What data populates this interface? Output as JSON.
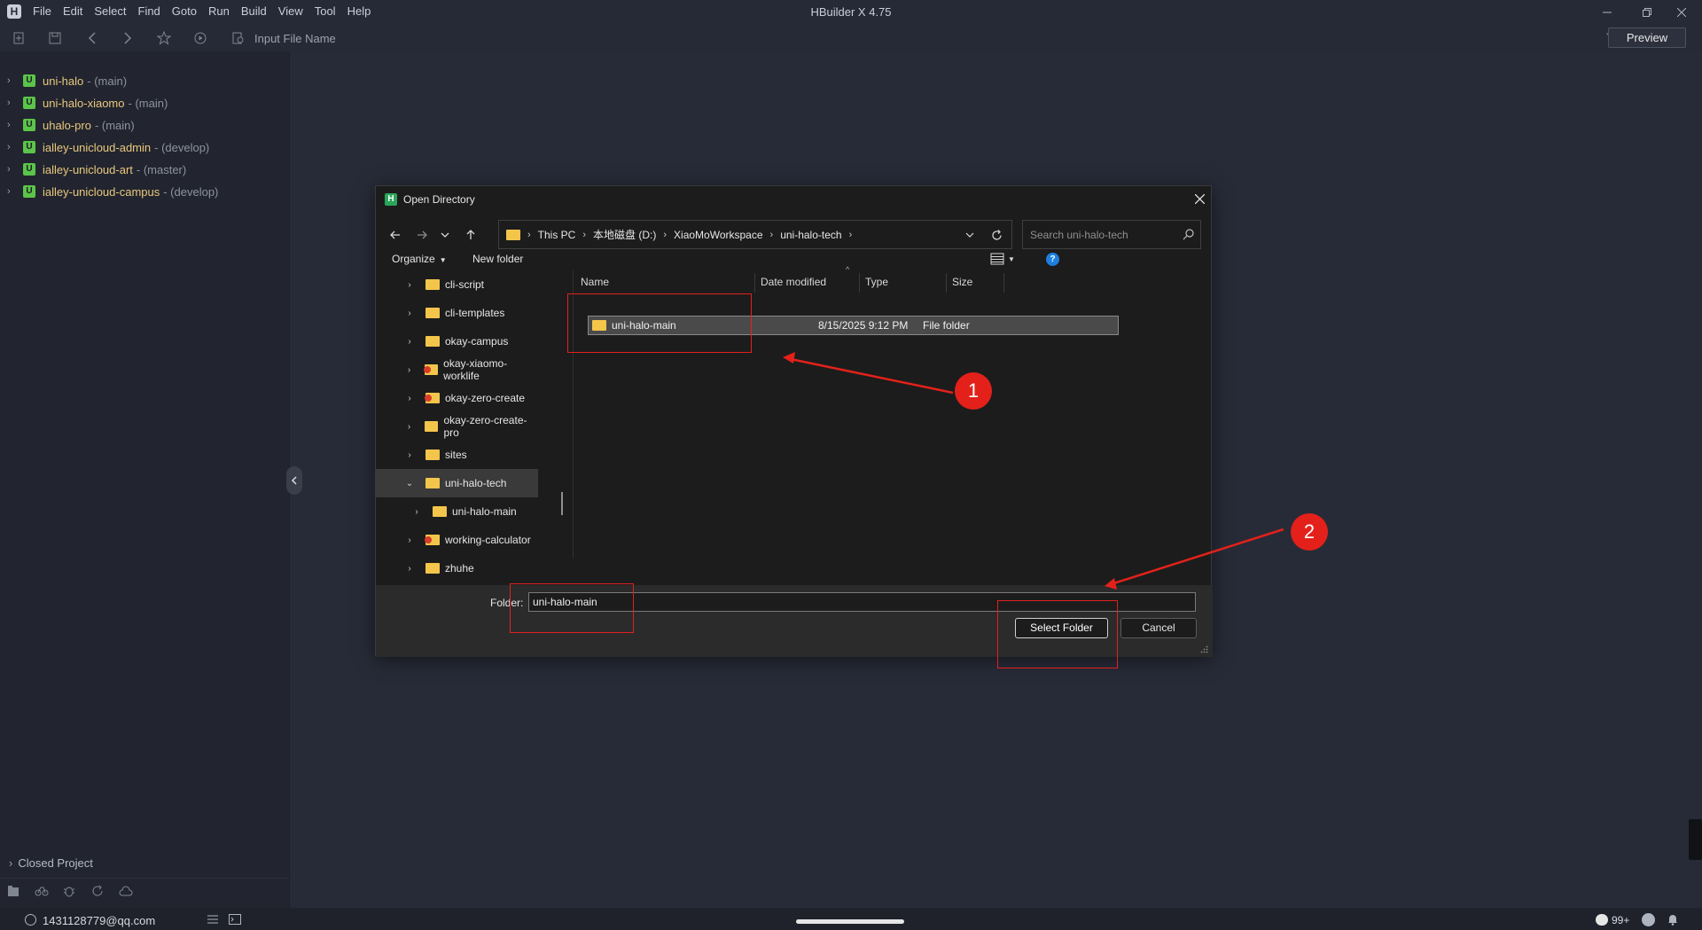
{
  "window": {
    "title": "HBuilder X 4.75",
    "logo": "H",
    "menu": [
      "File",
      "Edit",
      "Select",
      "Find",
      "Goto",
      "Run",
      "Build",
      "View",
      "Tool",
      "Help"
    ]
  },
  "toolbar": {
    "file_input_placeholder": "Input File Name",
    "preview_label": "Preview"
  },
  "sidebar": {
    "projects": [
      {
        "name": "uni-halo",
        "branch": "- (main)"
      },
      {
        "name": "uni-halo-xiaomo",
        "branch": "- (main)"
      },
      {
        "name": "uhalo-pro",
        "branch": "- (main)"
      },
      {
        "name": "ialley-unicloud-admin",
        "branch": "- (develop)"
      },
      {
        "name": "ialley-unicloud-art",
        "branch": "- (master)"
      },
      {
        "name": "ialley-unicloud-campus",
        "branch": "- (develop)"
      }
    ],
    "project_badge": "U",
    "closed_project_label": "Closed Project"
  },
  "statusbar": {
    "account": "1431128779@qq.com",
    "notification_count": "99+"
  },
  "dialog": {
    "title": "Open Directory",
    "breadcrumb": [
      "This PC",
      "本地磁盘 (D:)",
      "XiaoMoWorkspace",
      "uni-halo-tech"
    ],
    "search_placeholder": "Search uni-halo-tech",
    "organize_label": "Organize",
    "new_folder_label": "New folder",
    "help_glyph": "?",
    "tree": [
      {
        "name": "cli-script",
        "git": false,
        "expanded": false,
        "selected": false,
        "indent": 0
      },
      {
        "name": "cli-templates",
        "git": false,
        "expanded": false,
        "selected": false,
        "indent": 0
      },
      {
        "name": "okay-campus",
        "git": false,
        "expanded": false,
        "selected": false,
        "indent": 0
      },
      {
        "name": "okay-xiaomo-worklife",
        "git": true,
        "expanded": false,
        "selected": false,
        "indent": 0
      },
      {
        "name": "okay-zero-create",
        "git": true,
        "expanded": false,
        "selected": false,
        "indent": 0
      },
      {
        "name": "okay-zero-create-pro",
        "git": false,
        "expanded": false,
        "selected": false,
        "indent": 0
      },
      {
        "name": "sites",
        "git": false,
        "expanded": false,
        "selected": false,
        "indent": 0
      },
      {
        "name": "uni-halo-tech",
        "git": false,
        "expanded": true,
        "selected": true,
        "indent": 0
      },
      {
        "name": "uni-halo-main",
        "git": false,
        "expanded": false,
        "selected": false,
        "indent": 1
      },
      {
        "name": "working-calculator",
        "git": true,
        "expanded": false,
        "selected": false,
        "indent": 0
      },
      {
        "name": "zhuhe",
        "git": false,
        "expanded": false,
        "selected": false,
        "indent": 0
      }
    ],
    "columns": {
      "name": "Name",
      "date": "Date modified",
      "type": "Type",
      "size": "Size"
    },
    "files": [
      {
        "name": "uni-halo-main",
        "date": "8/15/2025 9:12 PM",
        "type": "File folder",
        "size": ""
      }
    ],
    "folder_label": "Folder:",
    "folder_value": "uni-halo-main",
    "select_label": "Select Folder",
    "cancel_label": "Cancel"
  },
  "annotations": {
    "step1": "1",
    "step2": "2",
    "color": "#e3211a"
  },
  "colors": {
    "editor_bg": "#272b37",
    "sidebar_bg": "#22252f",
    "project_name": "#e8c77e",
    "project_badge": "#5bc44a",
    "dialog_bg": "#1c1c1c",
    "folder_icon": "#f3c54a"
  }
}
